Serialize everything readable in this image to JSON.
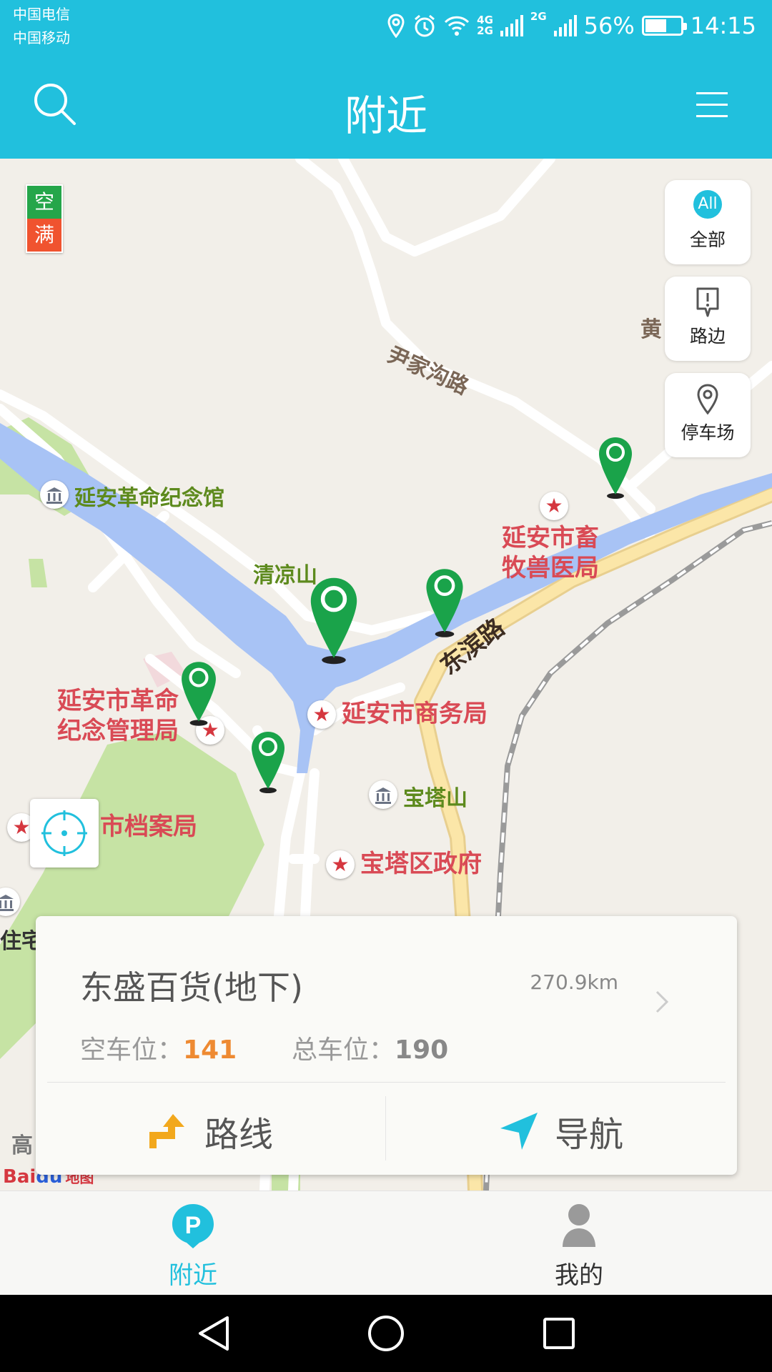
{
  "status_bar": {
    "carrier_1": "中国电信",
    "carrier_2": "中国移动",
    "net_1": "4G",
    "net_2": "2G",
    "net_3": "2G",
    "battery": "56%",
    "battery_level": 0.56,
    "time": "14:15"
  },
  "app_bar": {
    "title": "附近",
    "search_icon": "search-icon",
    "menu_icon": "menu-icon"
  },
  "map": {
    "legend": {
      "free": "空",
      "full": "满"
    },
    "filters": [
      {
        "badge": "All",
        "label": "全部",
        "icon": "all-icon"
      },
      {
        "label": "路边",
        "icon": "roadside-icon"
      },
      {
        "label": "停车场",
        "icon": "location-pin-icon"
      }
    ],
    "road_labels": [
      "尹家沟路",
      "东滨路"
    ],
    "place_labels": {
      "memorial_hall": "延安革命纪念馆",
      "qingliang": "清凉山",
      "baota": "宝塔山",
      "edge_huang": "黄",
      "edge_zhu": "住宅",
      "edge_gao": "高"
    },
    "poi_labels": {
      "vet": "延安市畜\n牧兽医局",
      "commerce": "延安市商务局",
      "revolution": "延安市革命\n纪念管理局",
      "archives": "市档案局",
      "district_gov": "宝塔区政府"
    },
    "logo": {
      "bai": "Bai",
      "du": "du",
      "ditu": "地图"
    }
  },
  "info_card": {
    "name": "东盛百货(地下)",
    "distance": "270.9km",
    "free_label": "空车位：",
    "free_value": "141",
    "total_label": "总车位：",
    "total_value": "190",
    "route_label": "路线",
    "nav_label": "导航"
  },
  "tabs": [
    {
      "label": "附近",
      "icon": "parking-icon",
      "active": true
    },
    {
      "label": "我的",
      "icon": "user-icon",
      "active": false
    }
  ],
  "colors": {
    "primary": "#21c0dd",
    "free": "#25a64a",
    "full": "#f0532f",
    "highlight": "#ee8a32",
    "pin": "#1aa34a",
    "river": "#a8c3f5"
  }
}
